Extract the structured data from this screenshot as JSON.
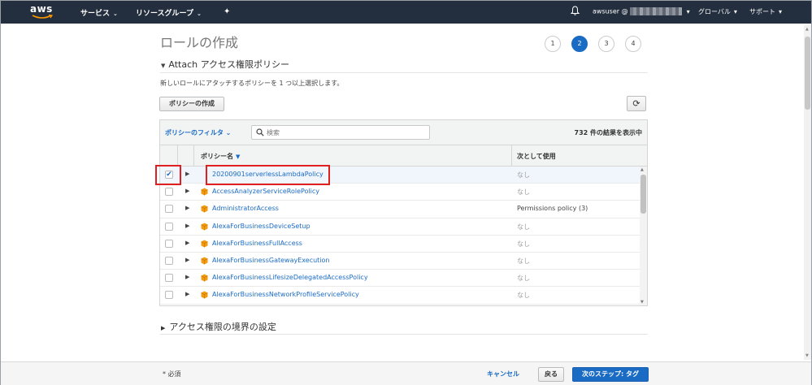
{
  "nav": {
    "logo": "aws",
    "services": "サービス",
    "resource_groups": "リソースグループ",
    "user": "awsuser @",
    "region": "グローバル",
    "support": "サポート",
    "icons": [
      "caret-down-icon",
      "pin-icon",
      "bell-icon"
    ]
  },
  "page": {
    "title": "ロールの作成",
    "steps": [
      "1",
      "2",
      "3",
      "4"
    ],
    "active_step": "2",
    "section_title": "Attach アクセス権限ポリシー",
    "description": "新しいロールにアタッチするポリシーを 1 つ以上選択します。",
    "create_policy_button": "ポリシーの作成",
    "refresh_icon": "refresh-icon"
  },
  "table": {
    "filter_label": "ポリシーのフィルタ",
    "search_placeholder": "検索",
    "result_count": "732 件の結果を表示中",
    "columns": [
      "ポリシー名",
      "次として使用"
    ],
    "rows": [
      {
        "name": "20200901serverlessLambdaPolicy",
        "usage": "なし",
        "checked": true,
        "aws_managed": false
      },
      {
        "name": "AccessAnalyzerServiceRolePolicy",
        "usage": "なし",
        "checked": false,
        "aws_managed": true
      },
      {
        "name": "AdministratorAccess",
        "usage": "Permissions policy (3)",
        "checked": false,
        "aws_managed": true
      },
      {
        "name": "AlexaForBusinessDeviceSetup",
        "usage": "なし",
        "checked": false,
        "aws_managed": true
      },
      {
        "name": "AlexaForBusinessFullAccess",
        "usage": "なし",
        "checked": false,
        "aws_managed": true
      },
      {
        "name": "AlexaForBusinessGatewayExecution",
        "usage": "なし",
        "checked": false,
        "aws_managed": true
      },
      {
        "name": "AlexaForBusinessLifesizeDelegatedAccessPolicy",
        "usage": "なし",
        "checked": false,
        "aws_managed": true
      },
      {
        "name": "AlexaForBusinessNetworkProfileServicePolicy",
        "usage": "なし",
        "checked": false,
        "aws_managed": true
      }
    ]
  },
  "boundary_section": "アクセス権限の境界の設定",
  "footer": {
    "required": "* 必須",
    "cancel": "キャンセル",
    "back": "戻る",
    "next": "次のステップ: タグ"
  },
  "colors": {
    "nav_bg": "#232f3e",
    "accent": "#1a6bc4",
    "highlight": "#e02020",
    "policy_icon": "#f39c12"
  }
}
